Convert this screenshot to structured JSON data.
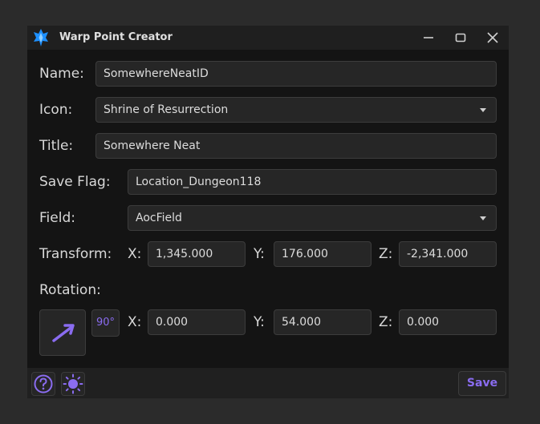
{
  "window": {
    "title": "Warp Point Creator",
    "logo_icon": "crystal-logo-icon",
    "accent_color": "#1e90ff"
  },
  "form": {
    "name_label": "Name:",
    "name_value": "SomewhereNeatID",
    "icon_label": "Icon:",
    "icon_value": "Shrine of Resurrection",
    "title_label": "Title:",
    "title_value": "Somewhere Neat",
    "save_flag_label": "Save Flag:",
    "save_flag_value": "Location_Dungeon118",
    "field_label": "Field:",
    "field_value": "AocField",
    "transform_label": "Transform:",
    "transform": {
      "x_label": "X:",
      "x_value": "1,345.000",
      "y_label": "Y:",
      "y_value": "176.000",
      "z_label": "Z:",
      "z_value": "-2,341.000"
    },
    "rotation_label": "Rotation:",
    "rotation": {
      "snap_label": "90°",
      "x_label": "X:",
      "x_value": "0.000",
      "y_label": "Y:",
      "y_value": "54.000",
      "z_label": "Z:",
      "z_value": "0.000"
    }
  },
  "footer": {
    "help_icon": "help-icon",
    "theme_icon": "sun-icon",
    "save_label": "Save",
    "accent_color": "#8a6cf0"
  }
}
